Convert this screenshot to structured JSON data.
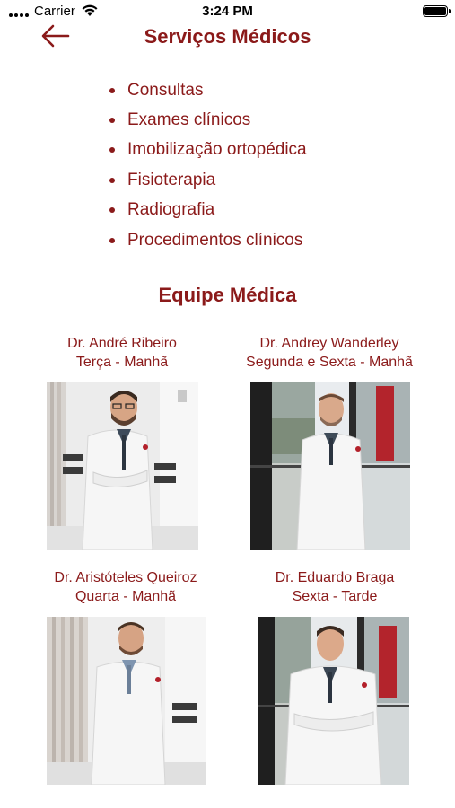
{
  "status_bar": {
    "carrier": "Carrier",
    "time": "3:24 PM"
  },
  "nav": {
    "title": "Serviços Médicos"
  },
  "services": [
    "Consultas",
    "Exames clínicos",
    "Imobilização ortopédica",
    "Fisioterapia",
    "Radiografia",
    "Procedimentos clínicos"
  ],
  "team": {
    "title": "Equipe Médica",
    "doctors": [
      {
        "name": "Dr. André Ribeiro",
        "schedule": "Terça - Manhã"
      },
      {
        "name": "Dr. Andrey Wanderley",
        "schedule": "Segunda e Sexta - Manhã"
      },
      {
        "name": "Dr. Aristóteles Queiroz",
        "schedule": "Quarta - Manhã"
      },
      {
        "name": "Dr. Eduardo Braga",
        "schedule": "Sexta - Tarde"
      }
    ]
  },
  "colors": {
    "accent": "#8b1a1a",
    "coat": "#f4f4f4",
    "background": "#ffffff"
  }
}
